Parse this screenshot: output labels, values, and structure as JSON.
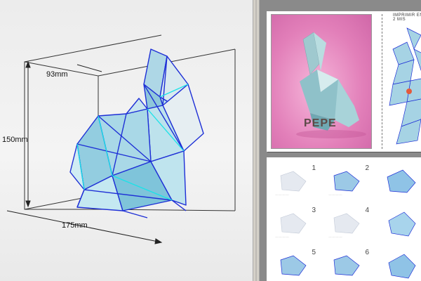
{
  "viewport": {
    "dimensions": {
      "depth": "93mm",
      "height": "150mm",
      "width": "175mm"
    }
  },
  "preview": {
    "sheet_title": "IMPRIMIR EN 1 Y 2 MIS",
    "cover_logo_text": "PEPE",
    "steps": [
      "1",
      "2",
      "3",
      "4",
      "5",
      "6"
    ]
  },
  "colors": {
    "viewport_bg": "#f0f0f0",
    "preview_bg": "#8a8a8a",
    "splitter": "#d4d0c8",
    "photo_pink": "#e27fb9",
    "mesh_edges": "#1e2fd6",
    "mesh_face": "#b9dde8",
    "edge_cyan": "#19e3e8"
  }
}
